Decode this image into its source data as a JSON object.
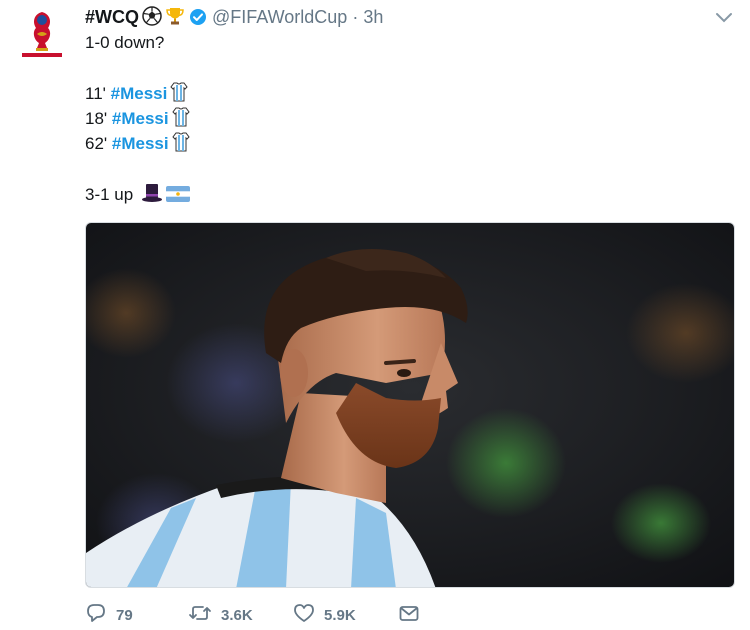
{
  "tweet": {
    "display_name": "#WCQ",
    "handle": "@FIFAWorldCup",
    "separator": "·",
    "time": "3h",
    "line1": "1-0 down?",
    "goals": [
      {
        "minute": "11'",
        "tag": "#Messi"
      },
      {
        "minute": "18'",
        "tag": "#Messi"
      },
      {
        "minute": "62'",
        "tag": "#Messi"
      }
    ],
    "line_final": "3-1 up",
    "name_emojis": [
      "soccer-ball-emoji",
      "trophy-emoji"
    ],
    "goal_emoji": "argentina-shirt-emoji",
    "final_emojis": [
      "top-hat-emoji",
      "argentina-flag-emoji"
    ]
  },
  "photo": {
    "subject": "player-portrait-photo"
  },
  "stats": {
    "replies": "79",
    "retweets": "3.6K",
    "likes": "5.9K"
  },
  "colors": {
    "link": "#1b95e0",
    "muted": "#657786",
    "verified": "#1da1f2"
  }
}
